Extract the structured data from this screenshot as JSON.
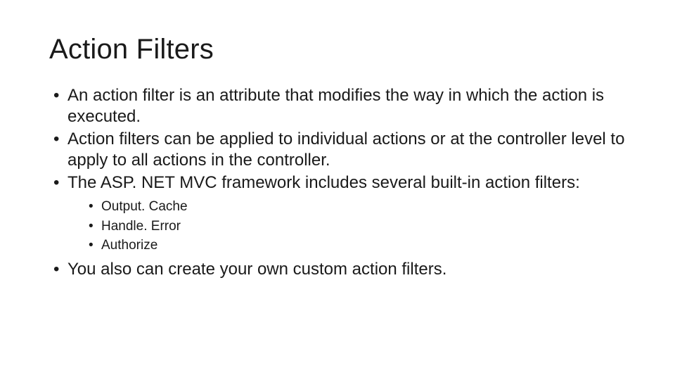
{
  "title": "Action Filters",
  "bullets": {
    "b1": "An action filter is an attribute that modifies the way in which the action is executed.",
    "b2": "Action filters can be applied to individual actions or at the controller level to apply to all actions in the controller.",
    "b3": "The ASP. NET MVC framework includes several built-in action filters:",
    "sub1": "Output. Cache",
    "sub2": "Handle. Error",
    "sub3": "Authorize",
    "b4": "You also can create your own custom action filters."
  }
}
